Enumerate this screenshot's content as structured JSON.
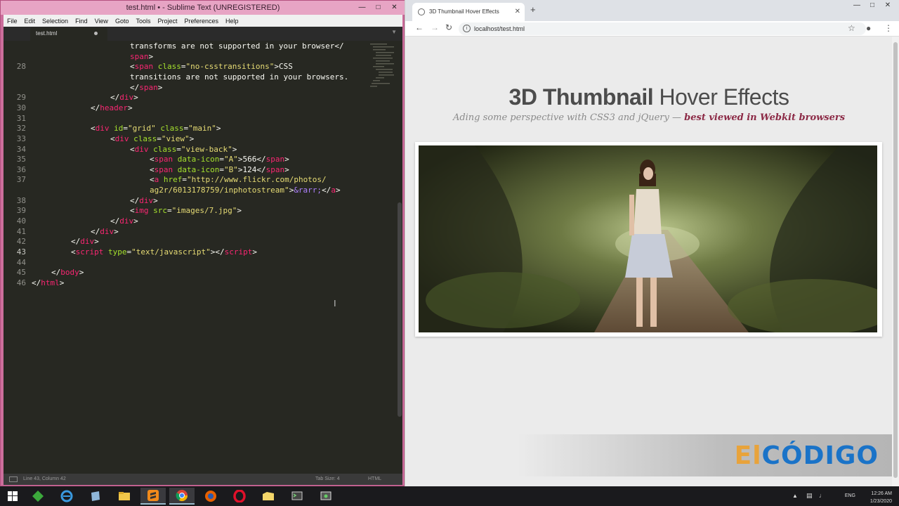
{
  "sublime": {
    "title": "test.html • - Sublime Text (UNREGISTERED)",
    "menu": [
      "File",
      "Edit",
      "Selection",
      "Find",
      "View",
      "Goto",
      "Tools",
      "Project",
      "Preferences",
      "Help"
    ],
    "tab": "test.html",
    "status_left": "Line 43, Column 42",
    "status_tab": "Tab Size: 4",
    "status_lang": "HTML",
    "line_numbers": [
      "28",
      "29",
      "30",
      "31",
      "32",
      "33",
      "34",
      "35",
      "36",
      "37",
      "38",
      "39",
      "40",
      "41",
      "42",
      "43",
      "44",
      "45",
      "46"
    ],
    "code_lines": [
      [
        [
          "t-txt",
          "transforms are not supported in your browser</"
        ]
      ],
      [
        [
          "t-tag",
          "span"
        ],
        [
          "t-p",
          ">"
        ]
      ],
      [
        [
          "t-p",
          "<"
        ],
        [
          "t-tag",
          "span"
        ],
        [
          "t-attr",
          " class"
        ],
        [
          "t-p",
          "="
        ],
        [
          "t-str",
          "\"no-csstransitions\""
        ],
        [
          "t-p",
          ">"
        ],
        [
          "t-txt",
          "CSS"
        ]
      ],
      [
        [
          "t-txt",
          "transitions are not supported in your browsers."
        ]
      ],
      [
        [
          "t-p",
          "</"
        ],
        [
          "t-tag",
          "span"
        ],
        [
          "t-p",
          ">"
        ]
      ],
      [
        [
          "t-p",
          "</"
        ],
        [
          "t-tag",
          "div"
        ],
        [
          "t-p",
          ">"
        ]
      ],
      [
        [
          "t-p",
          "</"
        ],
        [
          "t-tag",
          "header"
        ],
        [
          "t-p",
          ">"
        ]
      ],
      [],
      [
        [
          "t-p",
          "<"
        ],
        [
          "t-tag",
          "div"
        ],
        [
          "t-attr",
          " id"
        ],
        [
          "t-p",
          "="
        ],
        [
          "t-str",
          "\"grid\""
        ],
        [
          "t-attr",
          " class"
        ],
        [
          "t-p",
          "="
        ],
        [
          "t-str",
          "\"main\""
        ],
        [
          "t-p",
          ">"
        ]
      ],
      [
        [
          "t-p",
          "<"
        ],
        [
          "t-tag",
          "div"
        ],
        [
          "t-attr",
          " class"
        ],
        [
          "t-p",
          "="
        ],
        [
          "t-str",
          "\"view\""
        ],
        [
          "t-p",
          ">"
        ]
      ],
      [
        [
          "t-p",
          "<"
        ],
        [
          "t-tag",
          "div"
        ],
        [
          "t-attr",
          " class"
        ],
        [
          "t-p",
          "="
        ],
        [
          "t-str",
          "\"view-back\""
        ],
        [
          "t-p",
          ">"
        ]
      ],
      [
        [
          "t-p",
          "<"
        ],
        [
          "t-tag",
          "span"
        ],
        [
          "t-attr",
          " data-icon"
        ],
        [
          "t-p",
          "="
        ],
        [
          "t-str",
          "\"A\""
        ],
        [
          "t-p",
          ">"
        ],
        [
          "t-txt",
          "566"
        ],
        [
          "t-p",
          "</"
        ],
        [
          "t-tag",
          "span"
        ],
        [
          "t-p",
          ">"
        ]
      ],
      [
        [
          "t-p",
          "<"
        ],
        [
          "t-tag",
          "span"
        ],
        [
          "t-attr",
          " data-icon"
        ],
        [
          "t-p",
          "="
        ],
        [
          "t-str",
          "\"B\""
        ],
        [
          "t-p",
          ">"
        ],
        [
          "t-txt",
          "124"
        ],
        [
          "t-p",
          "</"
        ],
        [
          "t-tag",
          "span"
        ],
        [
          "t-p",
          ">"
        ]
      ],
      [
        [
          "t-p",
          "<"
        ],
        [
          "t-tag",
          "a"
        ],
        [
          "t-attr",
          " href"
        ],
        [
          "t-p",
          "="
        ],
        [
          "t-str",
          "\"http://www.flickr.com/photos/"
        ]
      ],
      [
        [
          "t-str",
          "ag2r/6013178759/inphotostream\""
        ],
        [
          "t-p",
          ">"
        ],
        [
          "t-ent",
          "&rarr;"
        ],
        [
          "t-p",
          "</"
        ],
        [
          "t-tag",
          "a"
        ],
        [
          "t-p",
          ">"
        ]
      ],
      [
        [
          "t-p",
          "</"
        ],
        [
          "t-tag",
          "div"
        ],
        [
          "t-p",
          ">"
        ]
      ],
      [
        [
          "t-p",
          "<"
        ],
        [
          "t-tag",
          "img"
        ],
        [
          "t-attr",
          " src"
        ],
        [
          "t-p",
          "="
        ],
        [
          "t-str",
          "\"images/7.jpg\""
        ],
        [
          "t-p",
          ">"
        ]
      ],
      [
        [
          "t-p",
          "</"
        ],
        [
          "t-tag",
          "div"
        ],
        [
          "t-p",
          ">"
        ]
      ],
      [
        [
          "t-p",
          "</"
        ],
        [
          "t-tag",
          "div"
        ],
        [
          "t-p",
          ">"
        ]
      ],
      [
        [
          "t-p",
          "</"
        ],
        [
          "t-tag",
          "div"
        ],
        [
          "t-p",
          ">"
        ]
      ],
      [
        [
          "t-p",
          "<"
        ],
        [
          "t-tag",
          "script"
        ],
        [
          "t-attr",
          " type"
        ],
        [
          "t-p",
          "="
        ],
        [
          "t-str",
          "\"text/javascript\""
        ],
        [
          "t-p",
          "></"
        ],
        [
          "t-tag",
          "script"
        ],
        [
          "t-p",
          ">"
        ]
      ],
      [],
      [
        [
          "t-p",
          "</"
        ],
        [
          "t-tag",
          "body"
        ],
        [
          "t-p",
          ">"
        ]
      ],
      [
        [
          "t-p",
          "</"
        ],
        [
          "t-tag",
          "html"
        ],
        [
          "t-p",
          ">"
        ]
      ]
    ]
  },
  "browser": {
    "tab_title": "3D Thumbnail Hover Effects",
    "url": "localhost/test.html",
    "page": {
      "title_bold": "3D Thumbnail",
      "title_light": "Hover Effects",
      "subtitle": "Ading some perspective with CSS3 and jQuery —",
      "subtitle_bold": "best viewed in Webkit browsers"
    },
    "brand_left": "El",
    "brand_right": "CÓDIGO"
  },
  "taskbar": {
    "lang": "ENG",
    "time": "12:26 AM",
    "date": "1/23/2020"
  }
}
